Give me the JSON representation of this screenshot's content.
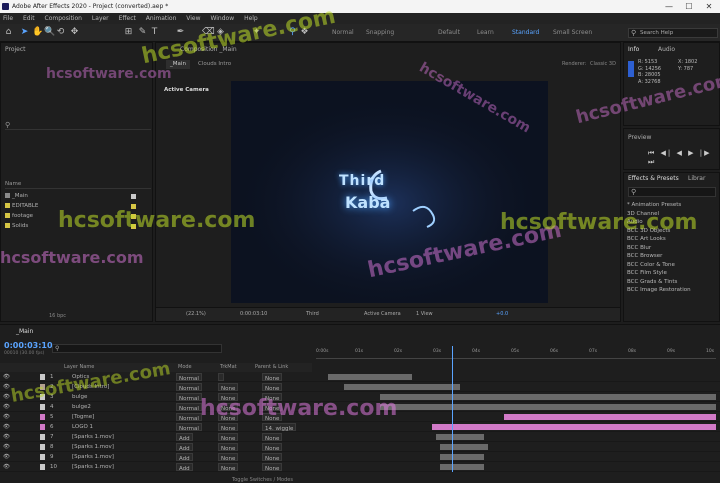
{
  "window": {
    "title": "Adobe After Effects 2020 - Project (converted).aep *",
    "minimize": "—",
    "maximize": "☐",
    "close": "✕"
  },
  "menu": [
    "File",
    "Edit",
    "Composition",
    "Layer",
    "Effect",
    "Animation",
    "View",
    "Window",
    "Help"
  ],
  "toolbar": {
    "tools": [
      "⌂",
      "➤",
      "✋",
      "🔍",
      "⟲",
      "✥",
      "⊞",
      "✎",
      "T",
      "✒",
      "⌫",
      "◈",
      "✦",
      "⚲",
      "❖"
    ],
    "workspaces": [
      "Default",
      "Learn",
      "Standard",
      "Small Screen"
    ],
    "active_workspace": "Standard",
    "search_placeholder": "Search Help",
    "snapping_label": "Snapping",
    "normal_label": "Normal"
  },
  "project": {
    "title": "Project",
    "search_icon": "search-icon",
    "header": "Name",
    "items": [
      {
        "name": "_Main",
        "type": "comp",
        "color": "#c9c9c9"
      },
      {
        "name": "EDITABLE",
        "type": "folder",
        "color": "#d6c645"
      },
      {
        "name": "footage",
        "type": "folder",
        "color": "#d6c645"
      },
      {
        "name": "Solids",
        "type": "folder",
        "color": "#d6c645"
      }
    ],
    "bpc": "16 bpc"
  },
  "composition": {
    "tab_title": "Composition _Main",
    "tabs": [
      "_Main",
      "Clouds Intro"
    ],
    "renderer": "Renderer:",
    "renderer_value": "Classic 3D",
    "active_camera_label": "Active Camera",
    "logo_text_1": "Third",
    "logo_text_2": "Kaba",
    "zoom": "(22.1%)",
    "timecode": "0:00:03:10",
    "resolution": "Third",
    "view": "Active Camera",
    "views": "1 View",
    "exposure": "+0.0"
  },
  "info": {
    "tabs": [
      "Info",
      "Audio"
    ],
    "values": [
      "R: 5153",
      "G: 14256",
      "B: 28005",
      "A: 32768"
    ],
    "coords": [
      "X: 1802",
      "Y: 787"
    ]
  },
  "preview": {
    "title": "Preview",
    "controls": [
      "⏮",
      "◀|",
      "◀",
      "▶",
      "|▶",
      "⏭"
    ]
  },
  "effects": {
    "tabs": [
      "Effects & Presets",
      "Librar"
    ],
    "search_placeholder": "",
    "items": [
      "* Animation Presets",
      "3D Channel",
      "Audio",
      "BCC 3D Objects",
      "BCC Art Looks",
      "BCC Blur",
      "BCC Browser",
      "BCC Color & Tone",
      "BCC Film Style",
      "BCC Grads & Tints",
      "BCC Image Restoration"
    ]
  },
  "timeline": {
    "comp_tab": "_Main",
    "timecode": "0:00:03:10",
    "subtime": "00010 (30.00 fps)",
    "headers": {
      "layer_name": "Layer Name",
      "mode": "Mode",
      "trkmat": "TrkMat",
      "parent": "Parent & Link"
    },
    "ruler_labels": [
      "0:00s",
      "01s",
      "02s",
      "03s",
      "04s",
      "05s",
      "06s",
      "07s",
      "08s",
      "09s",
      "10s"
    ],
    "toggle_label": "Toggle Switches / Modes",
    "layers": [
      {
        "num": "1",
        "name": "Optics",
        "mode": "Normal",
        "trkmat": "",
        "parent": "None",
        "label": "#c9c9c9",
        "bar_start": 0.03,
        "bar_end": 0.24,
        "pink": false
      },
      {
        "num": "2",
        "name": "[Clouds Intro]",
        "mode": "Normal",
        "trkmat": "None",
        "parent": "None",
        "label": "#b3a090",
        "bar_start": 0.07,
        "bar_end": 0.36,
        "pink": false
      },
      {
        "num": "3",
        "name": "bulge",
        "mode": "Normal",
        "trkmat": "None",
        "parent": "None",
        "label": "#c9c9c9",
        "bar_start": 0.16,
        "bar_end": 1.0,
        "pink": false
      },
      {
        "num": "4",
        "name": "bulge2",
        "mode": "Normal",
        "trkmat": "None",
        "parent": "None",
        "label": "#c9c9c9",
        "bar_start": 0.16,
        "bar_end": 1.0,
        "pink": false
      },
      {
        "num": "5",
        "name": "[Togme]",
        "mode": "Normal",
        "trkmat": "None",
        "parent": "None",
        "label": "#d27ac8",
        "bar_start": 0.47,
        "bar_end": 1.0,
        "pink": true
      },
      {
        "num": "6",
        "name": "LOGO 1",
        "mode": "Normal",
        "trkmat": "None",
        "parent": "14. wiggle",
        "label": "#d27ac8",
        "bar_start": 0.29,
        "bar_end": 1.0,
        "pink": true
      },
      {
        "num": "7",
        "name": "[Sparks 1.mov]",
        "mode": "Add",
        "trkmat": "None",
        "parent": "None",
        "label": "#c9c9c9",
        "bar_start": 0.3,
        "bar_end": 0.42,
        "pink": false
      },
      {
        "num": "8",
        "name": "[Sparks 1.mov]",
        "mode": "Add",
        "trkmat": "None",
        "parent": "None",
        "label": "#c9c9c9",
        "bar_start": 0.31,
        "bar_end": 0.43,
        "pink": false
      },
      {
        "num": "9",
        "name": "[Sparks 1.mov]",
        "mode": "Add",
        "trkmat": "None",
        "parent": "None",
        "label": "#c9c9c9",
        "bar_start": 0.31,
        "bar_end": 0.42,
        "pink": false
      },
      {
        "num": "10",
        "name": "[Sparks 1.mov]",
        "mode": "Add",
        "trkmat": "None",
        "parent": "None",
        "label": "#c9c9c9",
        "bar_start": 0.31,
        "bar_end": 0.42,
        "pink": false
      }
    ],
    "playhead": 0.34
  },
  "watermark": "hcsoftware.com",
  "colors": {
    "accent": "#5aa4ff",
    "pink": "#d27ac8",
    "folder": "#d6c645",
    "panel": "#1e1e1e"
  }
}
